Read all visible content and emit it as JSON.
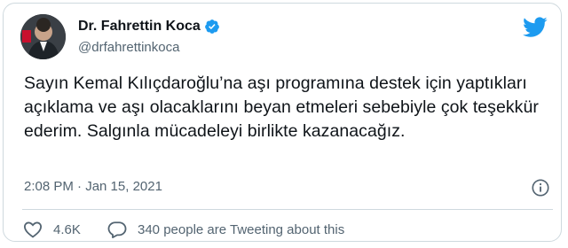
{
  "tweet": {
    "author_name": "Dr. Fahrettin Koca",
    "handle": "@drfahrettinkoca",
    "text": "Sayın Kemal Kılıçdaroğlu’na aşı programına destek için yaptıkları açıklama ve aşı olacaklarını beyan etmeleri sebebiyle çok teşekkür ederim. Salgınla mücadeleyi birlikte kazanacağız.",
    "timestamp": "2:08 PM · Jan 15, 2021",
    "likes": "4.6K",
    "tweeting_about": "340 people are Tweeting about this"
  },
  "colors": {
    "twitter_blue": "#1d9bf0",
    "secondary_text": "#536471",
    "border": "#cfd9de"
  },
  "icons": {
    "verified": "verified-badge-icon",
    "platform": "twitter-bird-icon",
    "info": "info-icon",
    "like": "heart-icon",
    "reply": "speech-bubble-icon"
  }
}
